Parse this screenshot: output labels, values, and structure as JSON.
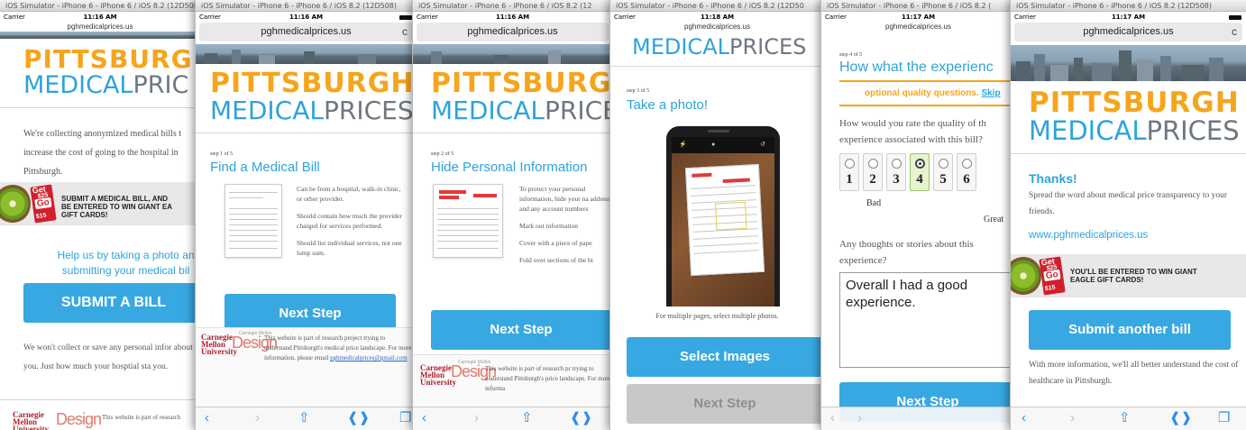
{
  "sim_titles": [
    "iOS Simulator - iPhone 6 - iPhone 6 / iOS 8.2 (12D508)",
    "iOS Simulator - iPhone 6 - iPhone 6 / iOS 8.2 (12D508)",
    "iOS Simulator - iPhone 6 - iPhone 6 / iOS 8.2 (12",
    "iOS Simulator - iPhone 6 - iPhone 6 / iOS 8.2 (12D50",
    "iOS Simulator - iPhone 6 - iPhone 6 / iOS 8.2 (",
    "iOS Simulator - iPhone 6 - iPhone 6 / iOS 8.2 (12D508)"
  ],
  "status": {
    "carrier": "Carrier",
    "wifi": "◉",
    "times": [
      "11:16 AM",
      "11:16 AM",
      "11:16 AM",
      "11:18 AM",
      "11:17 AM",
      "11:17 AM"
    ]
  },
  "url": "pghmedicalprices.us",
  "logo": {
    "top": "PITTSBURGH",
    "medical": "MEDICAL",
    "prices": "PRICES"
  },
  "s1": {
    "logo_top": "PITTSBURG",
    "logo_prices": "PRIC",
    "intro": "We're collecting anonymized medical bills t increase the cost of going to the hospital in Pittsburgh.",
    "promo_line1": "SUBMIT A MEDICAL BILL, AND",
    "promo_line2": "BE ENTERED TO WIN GIANT EA",
    "promo_line3": "GIFT CARDS!",
    "help_line1": "Help us by taking a photo an",
    "help_line2": "submitting your medical bil",
    "submit_label": "SUBMIT A BILL",
    "privacy": "We won't collect or save any personal infor about you. Just how much your hosptial sta you.",
    "footer_text": "This website is part of research"
  },
  "s2": {
    "step": "step 1 of 5",
    "title": "Find a Medical Bill",
    "tips": [
      "Can be from a hospital, walk-in clinic, or other provider.",
      "Should contain how much the provider charged for services performed.",
      "Should list individual services, not one lump sum."
    ],
    "next_label": "Next Step",
    "footer_text": "This website is part of research project trying to understand Pittsburgh's medical price landscape. For more information, please email ",
    "footer_link": "pghmedicalprices@gmail.com"
  },
  "s3": {
    "step": "step 2 of 5",
    "title": "Hide Personal Information",
    "tips": [
      "To protect your personal information, hide your na address, and any account numbers",
      "Mark out information",
      "Cover with a piece of pape",
      "Fold over sections of the bi"
    ],
    "next_label": "Next Step",
    "footer_text": "This website is part of research pr trying to understand Pittsburgh's price landscape. For more informa"
  },
  "s4": {
    "logo": "MEDICALPRICES",
    "step": "step 3 of 5",
    "title": "Take a photo!",
    "hint": "For multiple pages, select multiple photos.",
    "select_label": "Select Images",
    "next_label": "Next Step"
  },
  "s5": {
    "step": "step 4 of 5",
    "title": "How what the experienc",
    "optional": "optional quality questions.",
    "skip": "Skip",
    "question": "How would you rate the quality of th experience associated with this bill?",
    "ratings": [
      "1",
      "2",
      "3",
      "4",
      "5",
      "6"
    ],
    "selected_index": 3,
    "bad": "Bad",
    "great": "Great",
    "stories_q": "Any thoughts or stories about this experience?",
    "stories_value": "Overall I had a good experience.",
    "next_label": "Next Step"
  },
  "s6": {
    "thanks": "Thanks!",
    "spread": "Spread the word about medical price transparency to your friends.",
    "site_link": "www.pghmedicalprices.us",
    "promo_line1": "YOU'LL BE ENTERED TO WIN GIANT",
    "promo_line2": "EAGLE GIFT CARDS!",
    "submit_another": "Submit another bill",
    "more_info": "With more information, we'll all better understand the cost of healthcare in Pittsburgh."
  },
  "giftcard": {
    "get": "Get",
    "value": "$25",
    "go": "Go",
    "small": "$15"
  },
  "cmu_lines": [
    "Carnegie",
    "Mellon",
    "University"
  ],
  "design_label": "Design",
  "design_small": "Carnegie Mellon",
  "toolbar_icons": [
    "back-icon",
    "forward-icon",
    "share-icon",
    "bookmarks-icon",
    "tabs-icon"
  ],
  "colors": {
    "orange": "#f5a51c",
    "blue": "#2ea3dc",
    "button": "#37a8e1",
    "cmu_red": "#b01e2e"
  }
}
